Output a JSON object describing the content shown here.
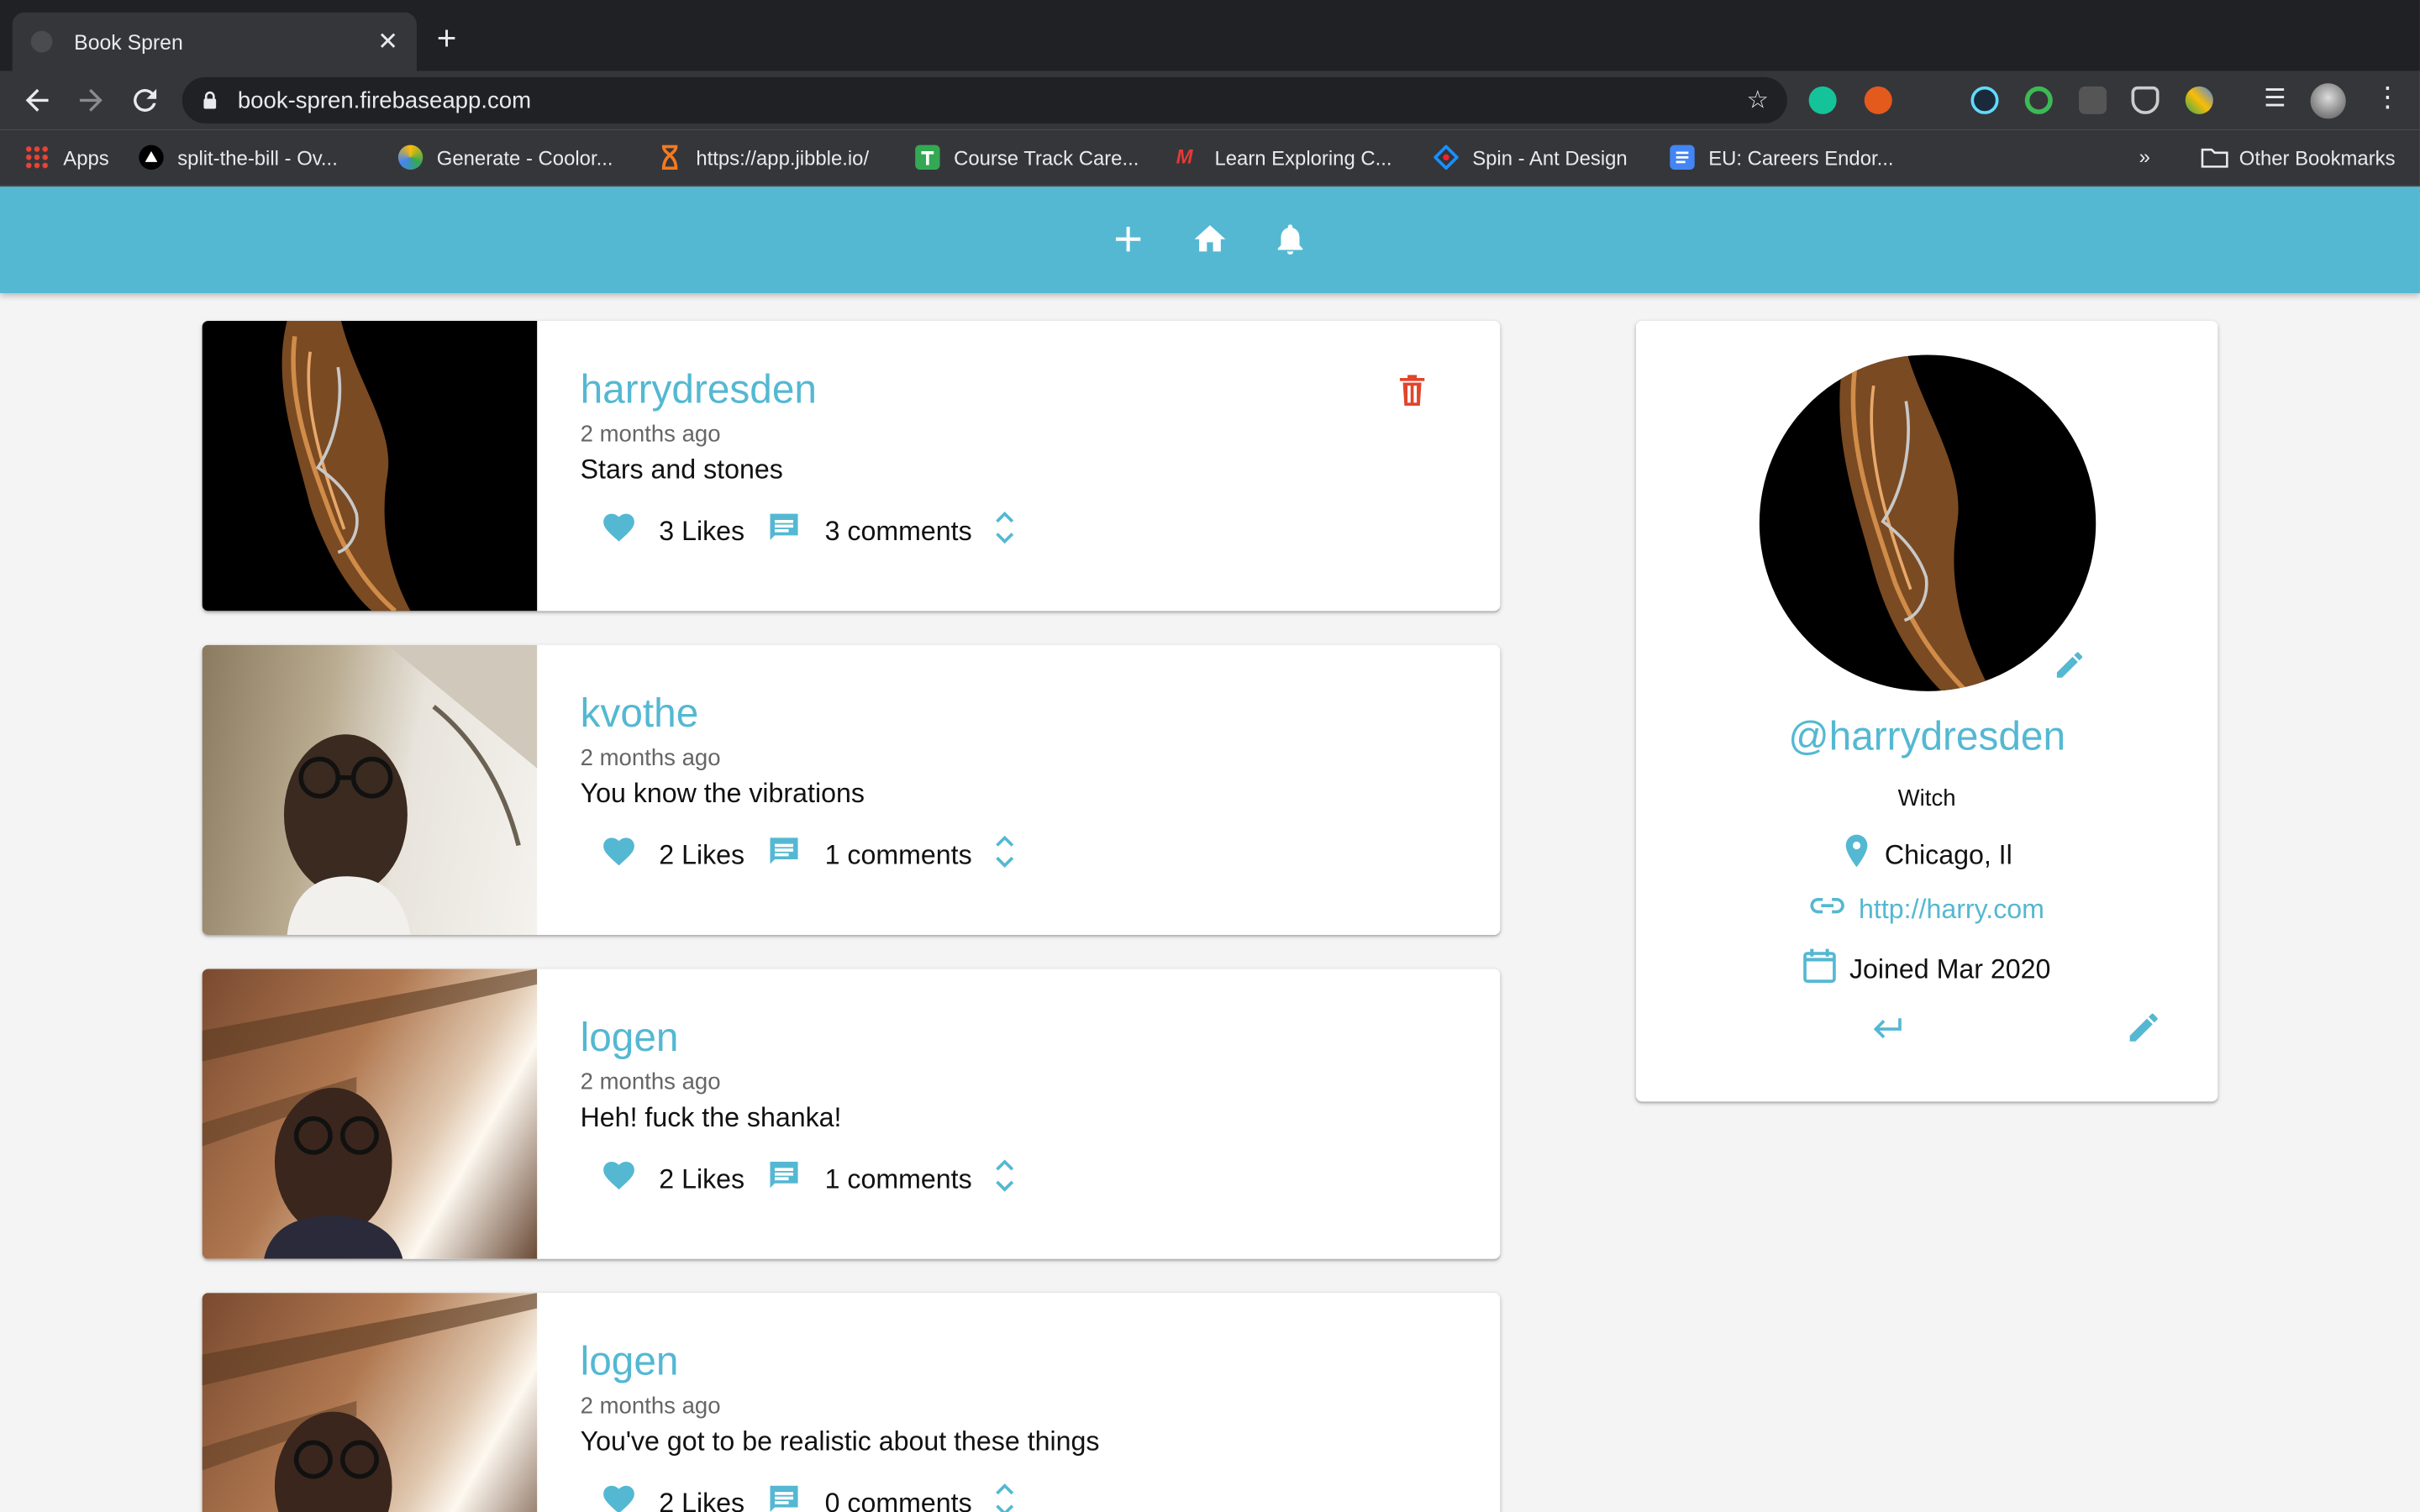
{
  "browser": {
    "tab_title": "Book Spren",
    "url": "book-spren.firebaseapp.com",
    "bookmarks": [
      {
        "label": "Apps",
        "icon": "apps-grid-icon"
      },
      {
        "label": "split-the-bill - Ov...",
        "icon": "triangle-icon"
      },
      {
        "label": "Generate - Coolor...",
        "icon": "coolors-icon"
      },
      {
        "label": "https://app.jibble.io/",
        "icon": "hourglass-icon"
      },
      {
        "label": "Course Track Care...",
        "icon": "sheets-icon"
      },
      {
        "label": "Learn Exploring C...",
        "icon": "m-logo-icon"
      },
      {
        "label": "Spin - Ant Design",
        "icon": "ant-design-icon"
      },
      {
        "label": "EU: Careers Endor...",
        "icon": "docs-icon"
      }
    ],
    "overflow_label": "»",
    "other_bookmarks": "Other Bookmarks"
  },
  "posts": [
    {
      "username": "harrydresden",
      "time": "2 months ago",
      "body": "Stars and stones",
      "likes": "3 Likes",
      "comments": "3 comments",
      "deletable": true,
      "image": "woman-profile"
    },
    {
      "username": "kvothe",
      "time": "2 months ago",
      "body": "You know the vibrations",
      "likes": "2 Likes",
      "comments": "1 comments",
      "deletable": false,
      "image": "man-car"
    },
    {
      "username": "logen",
      "time": "2 months ago",
      "body": "Heh! fuck the shanka!",
      "likes": "2 Likes",
      "comments": "1 comments",
      "deletable": false,
      "image": "man-window"
    },
    {
      "username": "logen",
      "time": "2 months ago",
      "body": "You've got to be realistic about these things",
      "likes": "2 Likes",
      "comments": "0 comments",
      "deletable": false,
      "image": "man-window"
    }
  ],
  "profile": {
    "handle": "@harrydresden",
    "bio": "Witch",
    "location": "Chicago, Il",
    "website": "http://harry.com",
    "joined": "Joined Mar 2020"
  },
  "colors": {
    "primary": "#54b8d2",
    "delete": "#e0452c",
    "background": "#f4f4f4"
  }
}
